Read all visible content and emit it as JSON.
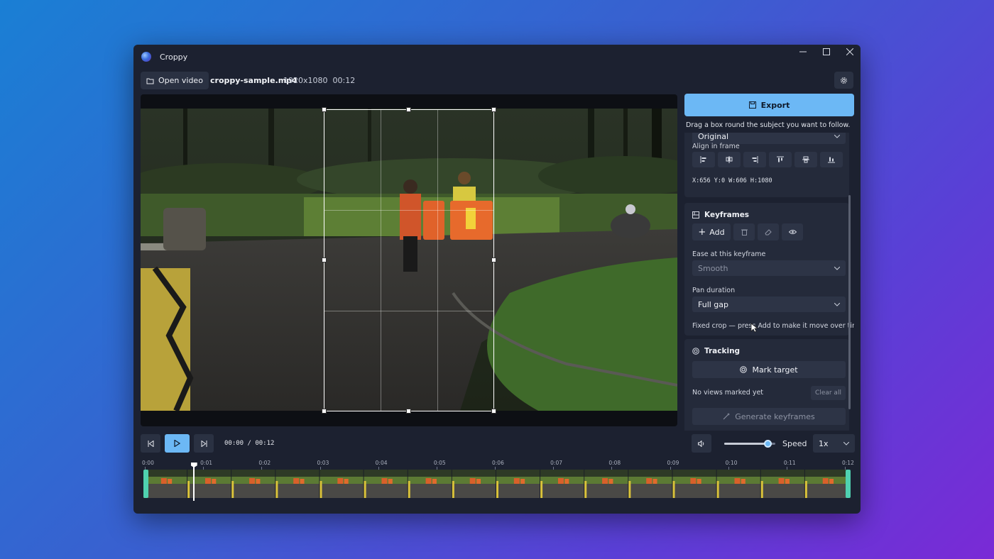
{
  "window": {
    "title": "Croppy"
  },
  "toolbar": {
    "open_label": "Open video",
    "filename": "croppy-sample.mp4",
    "resolution": "1920x1080",
    "duration": "00:12"
  },
  "sidebar": {
    "export_label": "Export",
    "hint": "Drag a box round the subject you want to follow.",
    "ratio_value": "Original",
    "align_label": "Align in frame",
    "align_buttons": [
      "align-left",
      "align-center-h",
      "align-right",
      "align-top",
      "align-center-v",
      "align-bottom"
    ],
    "coords": "X:656  Y:0  W:606  H:1080",
    "keyframes": {
      "title": "Keyframes",
      "add_label": "Add",
      "ease_label": "Ease at this keyframe",
      "ease_value": "Smooth",
      "pan_label": "Pan duration",
      "pan_value": "Full gap",
      "note": "Fixed crop — press Add to make it move over time"
    },
    "tracking": {
      "title": "Tracking",
      "mark_label": "Mark target",
      "status": "No views marked yet",
      "clear_label": "Clear all",
      "generate_label": "Generate keyframes"
    }
  },
  "transport": {
    "time": "00:00 / 00:12",
    "volume": 0.85,
    "speed_label": "Speed",
    "speed_value": "1x"
  },
  "timeline": {
    "ticks": [
      "0:00",
      "0:01",
      "0:02",
      "0:03",
      "0:04",
      "0:05",
      "0:06",
      "0:07",
      "0:08",
      "0:09",
      "0:10",
      "0:11",
      "0:12"
    ],
    "playhead_seconds": 0.83,
    "duration_seconds": 12
  },
  "colors": {
    "accent": "#6cb8f5",
    "trim": "#4fd1b0",
    "window": "#1c2130",
    "panel": "#242a3a"
  }
}
